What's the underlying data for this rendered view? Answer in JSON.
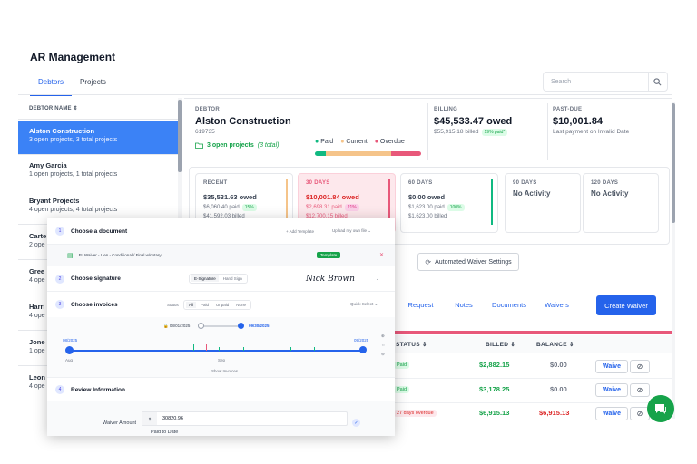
{
  "app": {
    "title": "AR Management"
  },
  "tabs": [
    "Debtors",
    "Projects"
  ],
  "search": {
    "placeholder": "Search"
  },
  "list": {
    "header": "DEBTOR NAME",
    "items": [
      {
        "name": "Alston Construction",
        "sub": "3 open projects, 3 total projects"
      },
      {
        "name": "Amy Garcia",
        "sub": "1 open projects, 1 total projects"
      },
      {
        "name": "Bryant Projects",
        "sub": "4 open projects, 4 total projects"
      },
      {
        "name": "Carte",
        "sub": "2 ope"
      },
      {
        "name": "Gree",
        "sub": "4 ope"
      },
      {
        "name": "Harri",
        "sub": "4 ope"
      },
      {
        "name": "Jone",
        "sub": "1 ope"
      },
      {
        "name": "Leon",
        "sub": "4 ope"
      }
    ]
  },
  "debtor": {
    "label": "DEBTOR",
    "name": "Alston Construction",
    "id": "619735",
    "open_projects": "3 open projects",
    "total_projects": "(3 total)",
    "legend": {
      "paid": "Paid",
      "current": "Current",
      "overdue": "Overdue"
    },
    "bar": {
      "paid": 0.1,
      "current": 0.62,
      "overdue": 0.28
    }
  },
  "billing": {
    "label": "BILLING",
    "owed": "$45,533.47 owed",
    "billed": "$55,915.18 billed",
    "paid_badge": "19% paid*"
  },
  "past_due": {
    "label": "PAST-DUE",
    "amount": "$10,001.84",
    "note": "Last payment on Invalid Date"
  },
  "aging": [
    {
      "label": "RECENT",
      "owed": "$35,531.63 owed",
      "paid": "$6,060.40 paid",
      "pct": "15%",
      "billed": "$41,592.03 billed"
    },
    {
      "label": "30 DAYS",
      "owed": "$10,001.84 owed",
      "paid": "$2,698.31 paid",
      "pct": "21%",
      "billed": "$12,700.15 billed"
    },
    {
      "label": "60 DAYS",
      "owed": "$0.00 owed",
      "paid": "$1,623.00 paid",
      "pct": "100%",
      "billed": "$1,623.00 billed"
    },
    {
      "label": "90 DAYS",
      "owed": "No Activity"
    },
    {
      "label": "120 DAYS",
      "owed": "No Activity"
    }
  ],
  "actions": {
    "auto_waiver": "Automated Waiver Settings",
    "links": [
      "Request",
      "Notes",
      "Documents",
      "Waivers"
    ],
    "create": "Create Waiver"
  },
  "table": {
    "headers": [
      "STATUS",
      "BILLED",
      "BALANCE"
    ],
    "rows": [
      {
        "status": "Paid",
        "billed": "$2,882.15",
        "balance": "$0.00",
        "waive": "Waive"
      },
      {
        "status": "Paid",
        "billed": "$3,178.25",
        "balance": "$0.00",
        "waive": "Waive"
      },
      {
        "status": "27 days overdue",
        "billed": "$6,915.13",
        "balance": "$6,915.13",
        "waive": "Waive"
      }
    ]
  },
  "waiver": {
    "steps": [
      {
        "num": "1",
        "title": "Choose a document",
        "a": "+ Add Template",
        "b": "Upload my own file"
      },
      {
        "num": "2",
        "title": "Choose signature",
        "a": "E-Signature",
        "b": "Hand Sign",
        "sig": "Nick Brown"
      },
      {
        "num": "3",
        "title": "Choose invoices",
        "status": "Status",
        "filters": [
          "All",
          "Paid",
          "Unpaid",
          "None"
        ],
        "quick": "Quick Select"
      },
      {
        "num": "4",
        "title": "Review Information"
      }
    ],
    "doc_name": "FL Waiver - Lien - Conditional / Final w/notary",
    "template_badge": "Template",
    "date_from": "08/01/2025",
    "date_to": "09/30/2025",
    "tl_start": "08/2025",
    "tl_end": "09/2025",
    "tl_aug": "Aug",
    "tl_sep": "Sep",
    "show_invoices": "Show Invoices",
    "amount_label": "Waiver Amount",
    "currency": "$",
    "amount": "30820.96",
    "paid_to_date": "Paid to Date"
  }
}
